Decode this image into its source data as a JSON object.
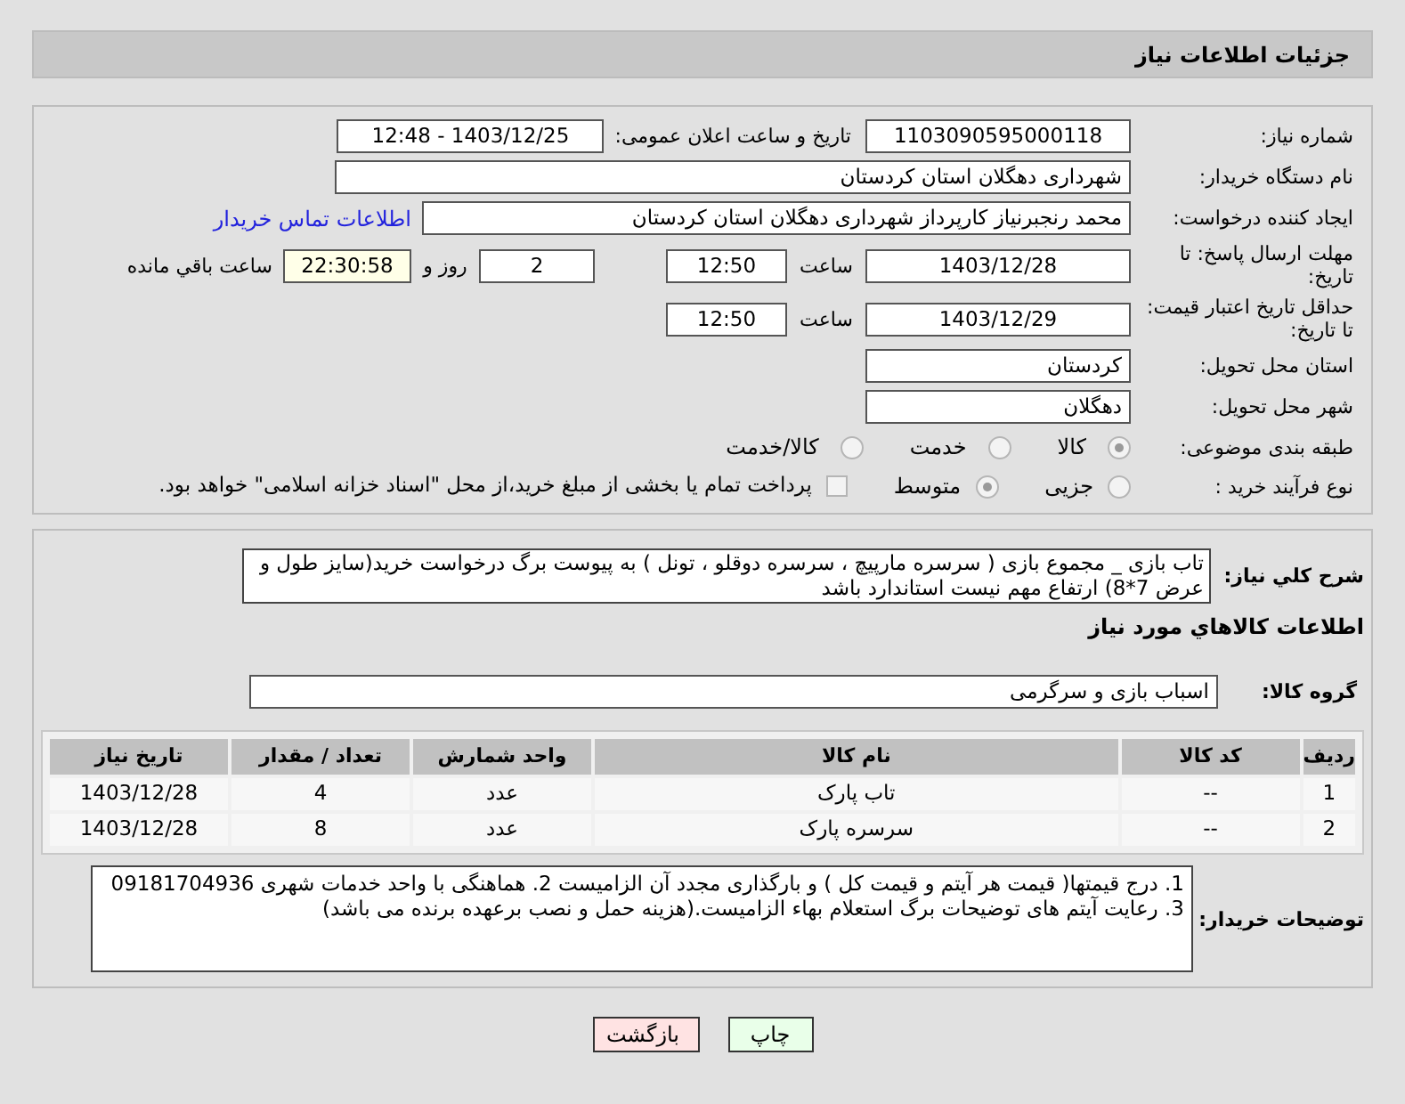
{
  "header": {
    "title": "جزئیات اطلاعات نیاز"
  },
  "need_number": {
    "label": "شماره نیاز:",
    "value": "1103090595000118"
  },
  "announce": {
    "label": "تاریخ و ساعت اعلان عمومی:",
    "value": "1403/12/25 - 12:48"
  },
  "buyer": {
    "label": "نام دستگاه خریدار:",
    "value": "شهرداری دهگلان استان کردستان"
  },
  "creator": {
    "label": "ایجاد کننده درخواست:",
    "value": "محمد رنجبرنیاز کارپرداز شهرداری دهگلان استان کردستان",
    "link": "اطلاعات تماس خریدار"
  },
  "deadline": {
    "label": "مهلت ارسال پاسخ: تا تاریخ:",
    "date": "1403/12/28",
    "time_label": "ساعت",
    "time": "12:50",
    "days": "2",
    "days_label": "روز و",
    "remaining": "22:30:58",
    "remaining_label": "ساعت باقي مانده"
  },
  "validity": {
    "label": "حداقل تاریخ اعتبار قیمت: تا تاریخ:",
    "date": "1403/12/29",
    "time_label": "ساعت",
    "time": "12:50"
  },
  "province": {
    "label": "استان محل تحویل:",
    "value": "کردستان"
  },
  "city": {
    "label": "شهر محل تحویل:",
    "value": "دهگلان"
  },
  "category": {
    "label": "طبقه بندی موضوعی:",
    "options": [
      {
        "label": "کالا",
        "selected": true
      },
      {
        "label": "خدمت",
        "selected": false
      },
      {
        "label": "کالا/خدمت",
        "selected": false
      }
    ]
  },
  "process": {
    "label": "نوع فرآیند خرید :",
    "options": [
      {
        "label": "جزیی",
        "selected": false
      },
      {
        "label": "متوسط",
        "selected": true
      }
    ],
    "treasury": {
      "label": "پرداخت تمام یا بخشی از مبلغ خرید،از محل \"اسناد خزانه اسلامی\" خواهد بود.",
      "checked": false
    }
  },
  "description": {
    "label": "شرح کلي نیاز:",
    "value": "تاب بازی _ مجموع بازی ( سرسره مارپیچ ، سرسره دوقلو ، تونل ) به پیوست برگ درخواست خرید(سایز طول و عرض 7*8) ارتفاع مهم نیست استاندارد باشد"
  },
  "goods_heading": "اطلاعات کالاهاي مورد نیاز",
  "goods_group": {
    "label": "گروه کالا:",
    "value": "اسباب بازی و سرگرمی"
  },
  "table": {
    "columns": [
      "ردیف",
      "کد کالا",
      "نام کالا",
      "واحد شمارش",
      "تعداد / مقدار",
      "تاریخ نیاز"
    ],
    "rows": [
      [
        "1",
        "--",
        "تاب پارک",
        "عدد",
        "4",
        "1403/12/28"
      ],
      [
        "2",
        "--",
        "سرسره پارک",
        "عدد",
        "8",
        "1403/12/28"
      ]
    ]
  },
  "notes": {
    "label": "توضیحات خریدار:",
    "value": "1. درج قیمتها( قیمت هر آیتم و قیمت کل ) و بارگذاری مجدد آن الزامیست 2. هماهنگی با واحد خدمات شهری 09181704936 3. رعایت آیتم های توضیحات برگ استعلام بهاء الزامیست.(هزینه حمل و نصب برعهده برنده می باشد)"
  },
  "buttons": [
    {
      "kind": "print",
      "label": "چاپ"
    },
    {
      "kind": "back",
      "label": "بازگشت"
    }
  ]
}
